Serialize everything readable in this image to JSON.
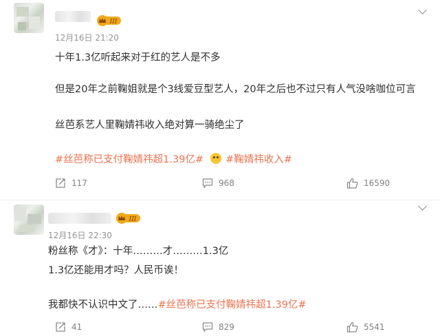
{
  "posts": [
    {
      "time": "12月16日 21:20",
      "lines": [
        "十年1.3亿听起来对于红的艺人是不多",
        "但是20年之前鞠姐就是个3线爱豆型艺人，20年之后也不过只有人气没啥咖位可言",
        "丝芭系艺人里鞠婧祎收入绝对算一骑绝尘了"
      ],
      "tag1": "#丝芭称已支付鞠婧祎超1.39亿#",
      "tag2": "#鞠婧祎收入#",
      "emoji": "doge-emoji",
      "actions": {
        "repost": "117",
        "comment": "968",
        "like": "16590"
      }
    },
    {
      "time": "12月16日 22:30",
      "lines": [
        "粉丝称《才》：十年………才………1.3亿",
        "1.3亿还能用才吗？人民币诶！"
      ],
      "last_line_prefix": "我都快不认识中文了……",
      "last_line_tag": "#丝芭称已支付鞠婧祎超1.39亿#",
      "actions": {
        "repost": "41",
        "comment": "829",
        "like": "5541"
      }
    }
  ],
  "colors": {
    "tag": "#eb7350",
    "time": "#939393",
    "vip": "#f2a91a"
  },
  "icons": [
    "vip-badge-icon",
    "chevron-down-icon",
    "repost-icon",
    "comment-icon",
    "like-icon"
  ]
}
